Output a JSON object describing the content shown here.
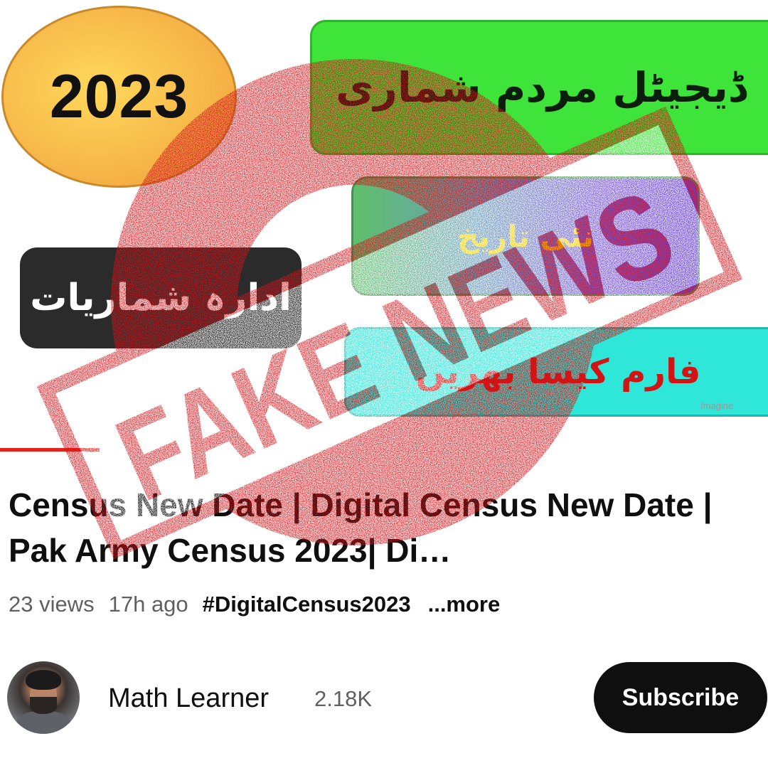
{
  "thumbnail": {
    "year": "2023",
    "urdu_digital_census": "ڈیجیٹل مردم شماری",
    "urdu_new_date": "نئی تاریخ",
    "urdu_form_failed": "فارم کیسا بھریں",
    "urdu_institution": "ادارہ شماریات",
    "watermark": "Imagine",
    "stamp_text": "FAKE NEWS"
  },
  "video": {
    "progress_fraction": 0.13,
    "title": "Census New Date | Digital Census New Date | Pak Army Census 2023| Di…",
    "views": "23 views",
    "age": "17h ago",
    "hashtag": "#DigitalCensus2023",
    "more": "...more"
  },
  "channel": {
    "name": "Math Learner",
    "subscribers": "2.18K",
    "subscribe_label": "Subscribe",
    "avatar_icon": "person-avatar"
  },
  "colors": {
    "stamp_red": "#d4141a",
    "progress_red": "#e5231b",
    "subscribe_bg": "#0f0f0f"
  }
}
